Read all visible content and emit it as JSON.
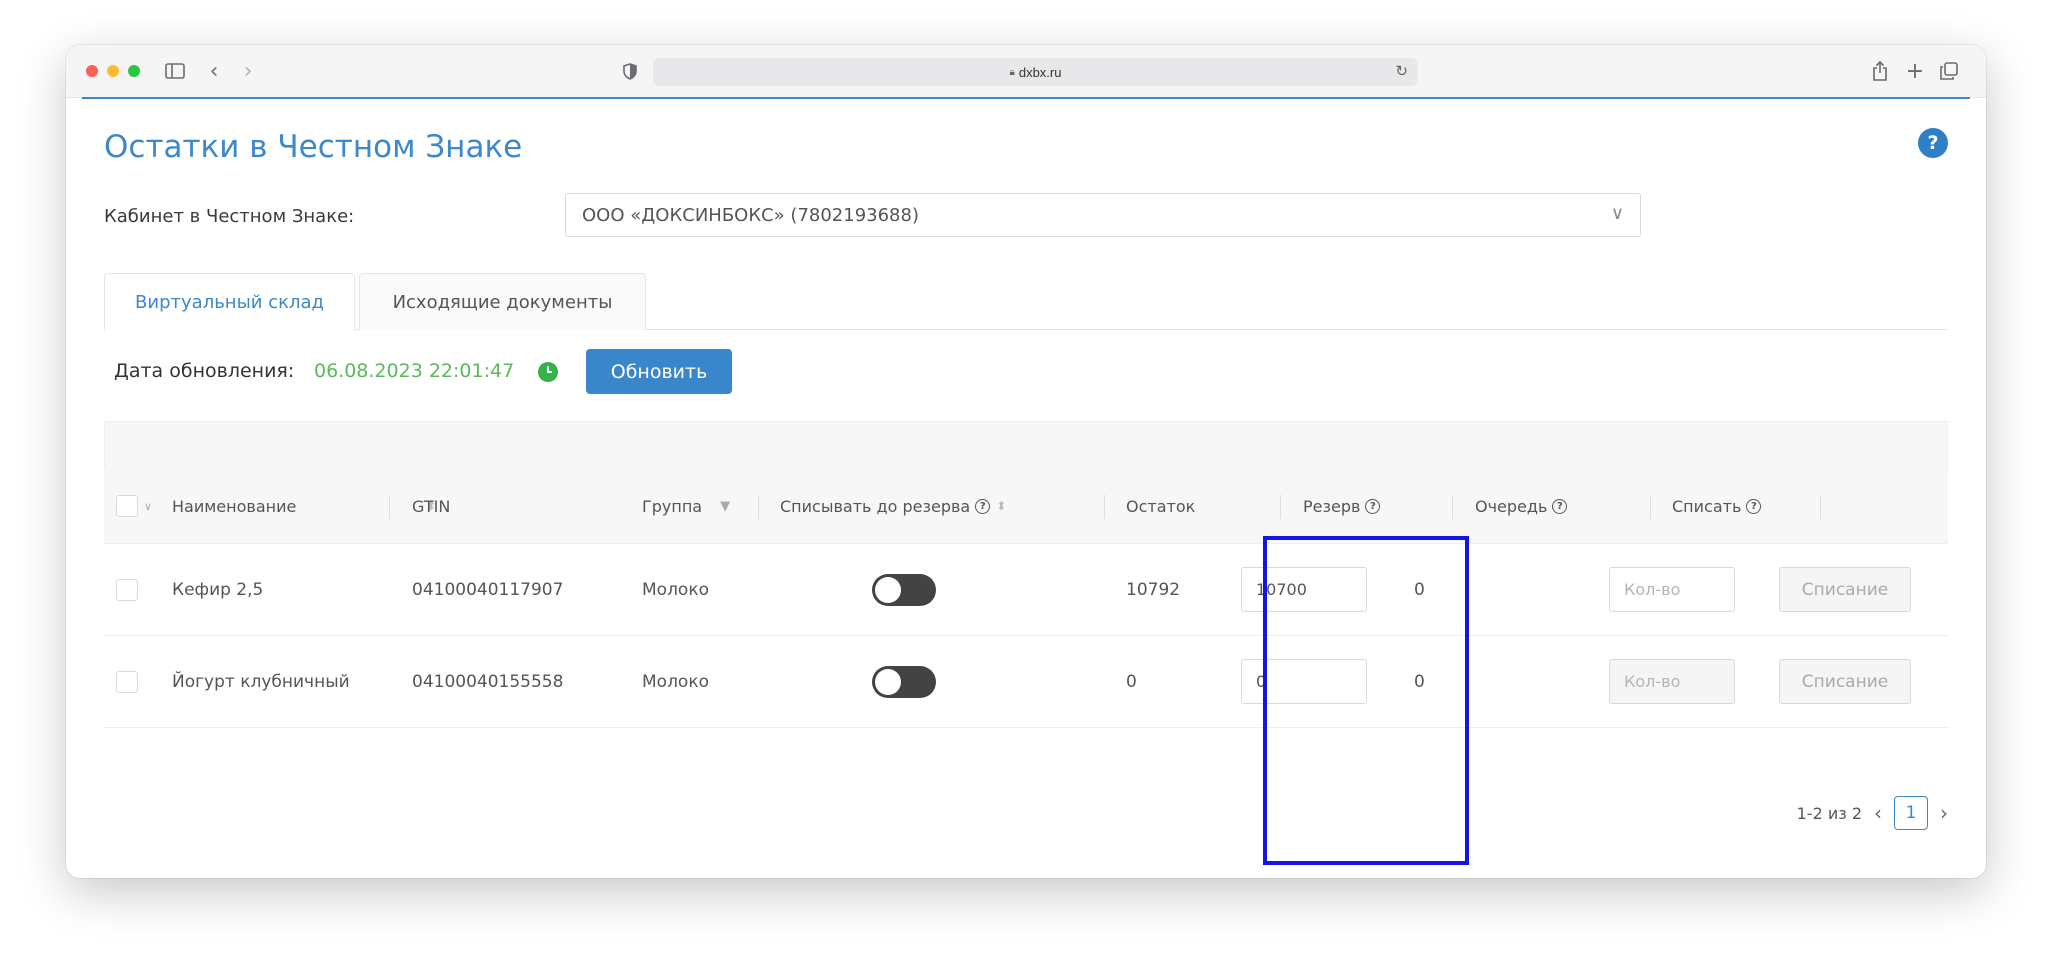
{
  "browser": {
    "url": "dxbx.ru",
    "traffic_lights": [
      "#ff5f57",
      "#febc2e",
      "#28c840"
    ]
  },
  "page": {
    "title": "Остатки в Честном Знаке",
    "help_icon": "?",
    "cabinet_label": "Кабинет в Честном Знаке:",
    "cabinet_value": "ООО «ДОКСИНБОКС» (7802193688)",
    "tabs": [
      {
        "label": "Виртуальный склад",
        "active": true
      },
      {
        "label": "Исходящие документы",
        "active": false
      }
    ],
    "update_label": "Дата обновления:",
    "update_date": "06.08.2023 22:01:47",
    "refresh_button": "Обновить"
  },
  "table": {
    "columns": {
      "name": "Наименование",
      "gtin": "GTIN",
      "group": "Группа",
      "write_off_to_reserve": "Списывать до резерва",
      "balance": "Остаток",
      "reserve": "Резерв",
      "queue": "Очередь",
      "write_off": "Списать"
    },
    "rows": [
      {
        "name": "Кефир 2,5",
        "gtin": "04100040117907",
        "group": "Молоко",
        "toggle": false,
        "balance": "10792",
        "reserve": "10700",
        "queue": "0",
        "qty_placeholder": "Кол-во",
        "action": "Списание"
      },
      {
        "name": "Йогурт клубничный",
        "gtin": "04100040155558",
        "group": "Молоко",
        "toggle": false,
        "balance": "0",
        "reserve": "0",
        "queue": "0",
        "qty_placeholder": "Кол-во",
        "action": "Списание"
      }
    ],
    "pagination": {
      "summary": "1-2 из 2",
      "current_page": "1"
    }
  },
  "colors": {
    "accent": "#3d88c9",
    "date": "#5cb85c",
    "highlight": "#1414e6"
  }
}
